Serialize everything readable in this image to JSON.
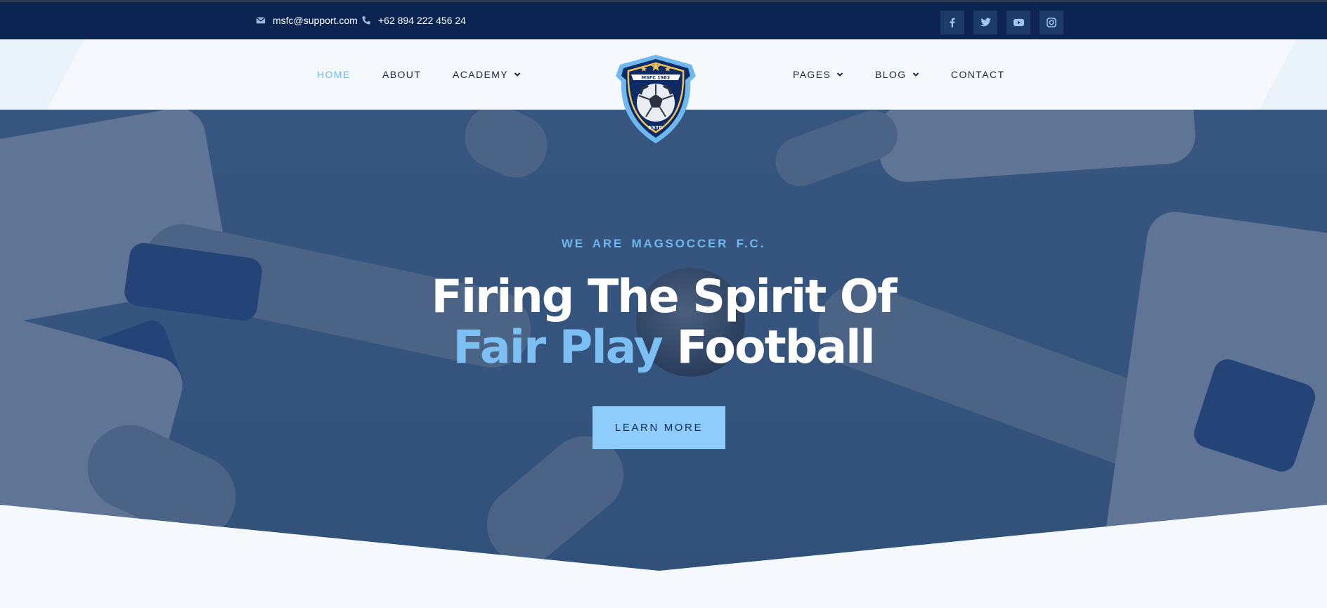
{
  "topbar": {
    "email": "msfc@support.com",
    "phone": "+62 894 222 456 24",
    "email_icon": "envelope-icon",
    "phone_icon": "phone-icon",
    "social": [
      {
        "name": "facebook",
        "icon": "facebook-icon"
      },
      {
        "name": "twitter",
        "icon": "twitter-icon"
      },
      {
        "name": "youtube",
        "icon": "youtube-icon"
      },
      {
        "name": "instagram",
        "icon": "instagram-icon"
      }
    ]
  },
  "nav": {
    "left": [
      {
        "label": "HOME",
        "active": true
      },
      {
        "label": "ABOUT",
        "active": false
      },
      {
        "label": "ACADEMY",
        "active": false,
        "has_dropdown": true
      }
    ],
    "right": [
      {
        "label": "PAGES",
        "active": false,
        "has_dropdown": true
      },
      {
        "label": "BLOG",
        "active": false,
        "has_dropdown": true
      },
      {
        "label": "CONTACT",
        "active": false
      }
    ]
  },
  "logo": {
    "banner": "MSFC 1982",
    "estd": "ESTD"
  },
  "hero": {
    "subtitle": "WE ARE  MAGSOCCER  F.C.",
    "headline_line1": "Firing The Spirit Of",
    "headline_accent": "Fair Play",
    "headline_rest": " Football",
    "cta_label": "LEARN MORE"
  },
  "colors": {
    "topbar_bg": "#0b2452",
    "accent": "#6eb8ef",
    "cta_bg": "#8ecdfb",
    "nav_text": "#1a2740",
    "page_bg": "#f5f9fd"
  }
}
